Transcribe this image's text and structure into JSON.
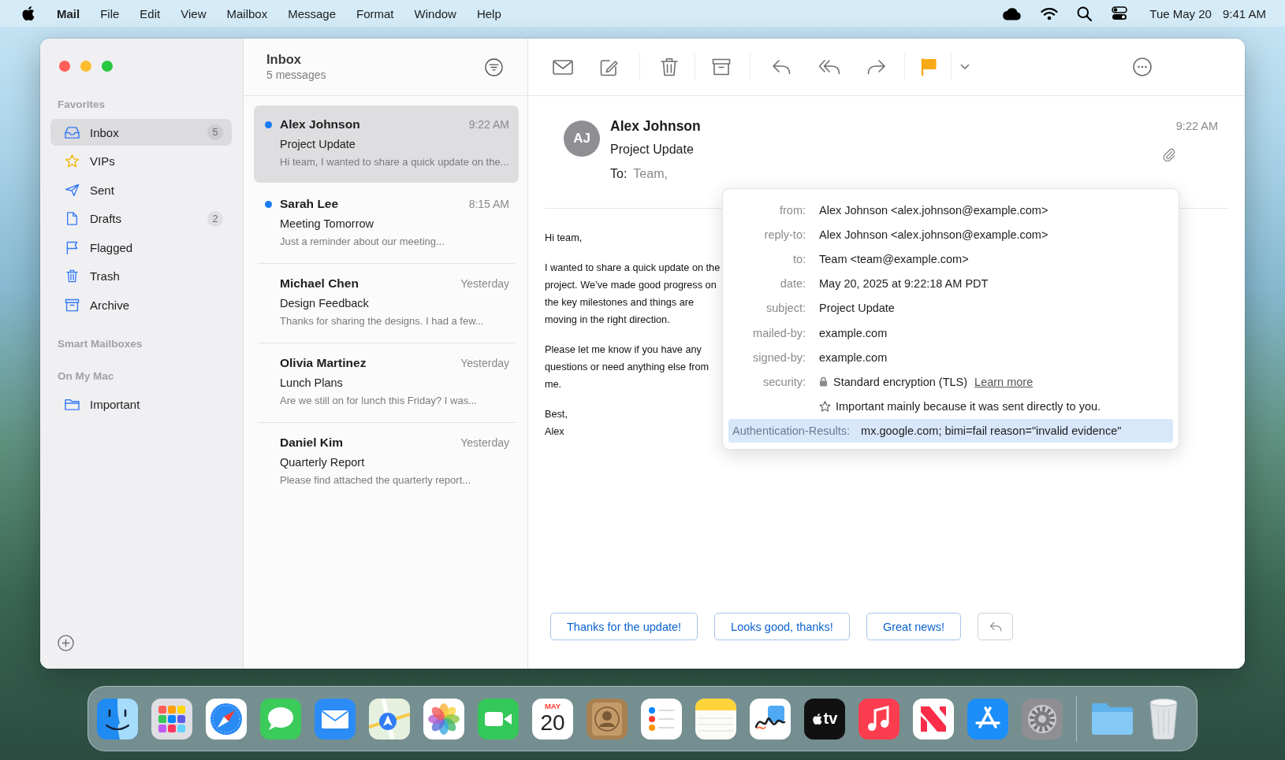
{
  "menu_bar": {
    "app_name": "Mail",
    "menus": [
      "File",
      "Edit",
      "View",
      "Mailbox",
      "Message",
      "Format",
      "Window",
      "Help"
    ],
    "date": "Tue May 20",
    "time": "9:41 AM"
  },
  "sidebar": {
    "sections": [
      {
        "title": "Favorites",
        "items": [
          {
            "label": "Inbox",
            "kind": "inbox",
            "count": "5",
            "selected": true
          },
          {
            "label": "VIPs",
            "kind": "star",
            "selected": false
          },
          {
            "label": "Sent",
            "kind": "sent",
            "selected": false
          },
          {
            "label": "Drafts",
            "kind": "drafts",
            "count": "2",
            "selected": false
          },
          {
            "label": "Flagged",
            "kind": "flag",
            "selected": false
          },
          {
            "label": "Trash",
            "kind": "trash",
            "selected": false
          },
          {
            "label": "Archive",
            "kind": "archive",
            "selected": false
          }
        ]
      },
      {
        "title": "Smart Mailboxes"
      },
      {
        "title": "On My Mac",
        "items": [
          {
            "label": "Important",
            "kind": "folder",
            "selected": false
          }
        ]
      }
    ]
  },
  "message_list": {
    "title": "Inbox",
    "subtitle": "5 messages",
    "messages": [
      {
        "sender": "Alex Johnson",
        "time": "9:22 AM",
        "subject": "Project Update",
        "preview": "Hi team, I wanted to share a quick update on the...",
        "unread": true,
        "selected": true
      },
      {
        "sender": "Sarah Lee",
        "time": "8:15 AM",
        "subject": "Meeting Tomorrow",
        "preview": "Just a reminder about our meeting...",
        "unread": true,
        "selected": false
      },
      {
        "sender": "Michael Chen",
        "time": "Yesterday",
        "subject": "Design Feedback",
        "preview": "Thanks for sharing the designs. I had a few...",
        "unread": false,
        "selected": false
      },
      {
        "sender": "Olivia Martinez",
        "time": "Yesterday",
        "subject": "Lunch Plans",
        "preview": "Are we still on for lunch this Friday? I was...",
        "unread": false,
        "selected": false
      },
      {
        "sender": "Daniel Kim",
        "time": "Yesterday",
        "subject": "Quarterly Report",
        "preview": "Please find attached the quarterly report...",
        "unread": false,
        "selected": false
      }
    ]
  },
  "message": {
    "initials": "AJ",
    "sender": "Alex Johnson",
    "subject": "Project Update",
    "to_label": "To:",
    "to": "Team,",
    "time": "9:22 AM",
    "has_attachment": true,
    "body": [
      [
        "Hi team,"
      ],
      [
        "I wanted to share a quick update on the project. We’ve made good progress on the key milestones and things are moving in the right direction."
      ],
      [
        "Please let me know if you have any questions or need anything else from me."
      ],
      [
        "Best,",
        "Alex"
      ]
    ]
  },
  "details_popover": {
    "rows": [
      {
        "kind": "field",
        "label": "from:",
        "value": "Alex Johnson <alex.johnson@example.com>"
      },
      {
        "kind": "field",
        "label": "reply-to:",
        "value": "Alex Johnson <alex.johnson@example.com>"
      },
      {
        "kind": "field",
        "label": "to:",
        "value": "Team <team@example.com>"
      },
      {
        "kind": "field",
        "label": "date:",
        "value": "May 20, 2025 at 9:22:18 AM PDT"
      },
      {
        "kind": "field",
        "label": "subject:",
        "value": "Project Update"
      },
      {
        "kind": "field",
        "label": "mailed-by:",
        "value": "example.com"
      },
      {
        "kind": "field",
        "label": "signed-by:",
        "value": "example.com"
      },
      {
        "kind": "security",
        "label": "security:",
        "value": "Standard encryption (TLS)",
        "link": "Learn more"
      },
      {
        "kind": "note",
        "value": "Important mainly because it was sent directly to you."
      }
    ],
    "authentication": {
      "label": "Authentication-Results:",
      "value": "mx.google.com; bimi=fail reason=\"invalid evidence\"",
      "selected": true
    }
  },
  "quick_replies": [
    "Thanks for the update!",
    "Looks good, thanks!",
    "Great news!"
  ],
  "dock": {
    "apps": [
      {
        "kind": "finder"
      },
      {
        "kind": "launchpad"
      },
      {
        "kind": "safari"
      },
      {
        "kind": "messages"
      },
      {
        "kind": "mail"
      },
      {
        "kind": "maps"
      },
      {
        "kind": "photos"
      },
      {
        "kind": "facetime"
      },
      {
        "kind": "calendar",
        "month": "MAY",
        "day": "20"
      },
      {
        "kind": "contacts"
      },
      {
        "kind": "reminders"
      },
      {
        "kind": "notes"
      },
      {
        "kind": "freeform"
      },
      {
        "kind": "tv",
        "label": "tv"
      },
      {
        "kind": "music"
      },
      {
        "kind": "news"
      },
      {
        "kind": "appstore"
      },
      {
        "kind": "settings"
      }
    ],
    "stack": [
      {
        "kind": "folder"
      },
      {
        "kind": "trash"
      }
    ]
  }
}
